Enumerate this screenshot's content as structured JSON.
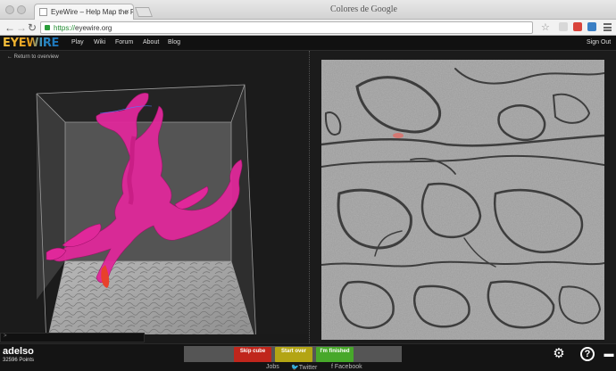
{
  "browser": {
    "tab_title": "EyeWire – Help Map the Reti",
    "titlebar_text": "Colores de Google",
    "url_scheme": "https://",
    "url_host": "eyewire.org",
    "back_icon": "back-arrow-icon",
    "forward_icon": "forward-arrow-icon",
    "reload_icon": "reload-icon",
    "star_icon": "star-icon",
    "menu_icon": "menu-icon",
    "extension_colors": [
      "#d8d8d8",
      "#d9443b",
      "#3b7fc4"
    ]
  },
  "site": {
    "logo": "EYEWIRE",
    "nav": [
      "Play",
      "Wiki",
      "Forum",
      "About",
      "Blog"
    ],
    "signout": "Sign Out",
    "back_link": "← Return to overview"
  },
  "viewer": {
    "console_prompt": ">",
    "neuron_color": "#e0289a"
  },
  "user": {
    "name": "adelso",
    "points": "32596 Points"
  },
  "actions": {
    "skip": "Skip cube",
    "start_over": "Start over",
    "finished": "I'm finished",
    "skip_color": "#c0261c",
    "start_over_color": "#b3a514",
    "finished_color": "#47a82a"
  },
  "footer": {
    "jobs": "Jobs",
    "twitter": "Twitter",
    "facebook": "Facebook"
  },
  "icons": {
    "settings": "gear-icon",
    "help": "help-icon",
    "chat": "chat-icon"
  }
}
